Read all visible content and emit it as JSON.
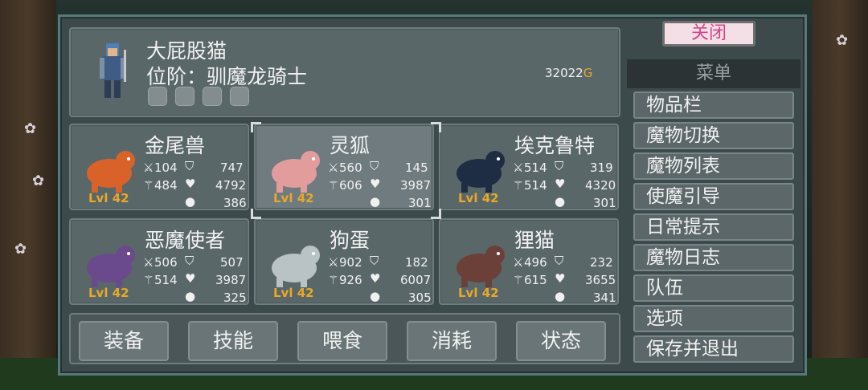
{
  "player": {
    "name": "大屁股猫",
    "rank": "位阶：驯魔龙骑士",
    "gold": "32022",
    "gold_unit": "G"
  },
  "monsters": [
    {
      "name": "金尾兽",
      "atk": "104",
      "def": "747",
      "mag": "484",
      "hp": "4792",
      "mana": "386",
      "level": "Lvl 42",
      "color": "#d9622b"
    },
    {
      "name": "灵狐",
      "atk": "560",
      "def": "145",
      "mag": "606",
      "hp": "3987",
      "mana": "301",
      "level": "Lvl 42",
      "color": "#e39c9c"
    },
    {
      "name": "埃克鲁特",
      "atk": "514",
      "def": "319",
      "mag": "514",
      "hp": "4320",
      "mana": "301",
      "level": "Lvl 42",
      "color": "#1e2c44"
    },
    {
      "name": "恶魔使者",
      "atk": "506",
      "def": "507",
      "mag": "514",
      "hp": "3987",
      "mana": "325",
      "level": "Lvl 42",
      "color": "#6a4a8c"
    },
    {
      "name": "狗蛋",
      "atk": "902",
      "def": "182",
      "mag": "926",
      "hp": "6007",
      "mana": "305",
      "level": "Lvl 42",
      "color": "#b9c3c5"
    },
    {
      "name": "狸猫",
      "atk": "496",
      "def": "232",
      "mag": "615",
      "hp": "3655",
      "mana": "341",
      "level": "Lvl 42",
      "color": "#6a4038"
    }
  ],
  "actions": [
    "装备",
    "技能",
    "喂食",
    "消耗",
    "状态"
  ],
  "menu": {
    "close_label": "关闭",
    "title": "菜单",
    "items": [
      "物品栏",
      "魔物切换",
      "魔物列表",
      "使魔引导",
      "日常提示",
      "魔物日志",
      "队伍",
      "选项",
      "保存并退出"
    ]
  },
  "colors": {
    "accent_gold": "#e8a82a",
    "close_text": "#d64588"
  }
}
